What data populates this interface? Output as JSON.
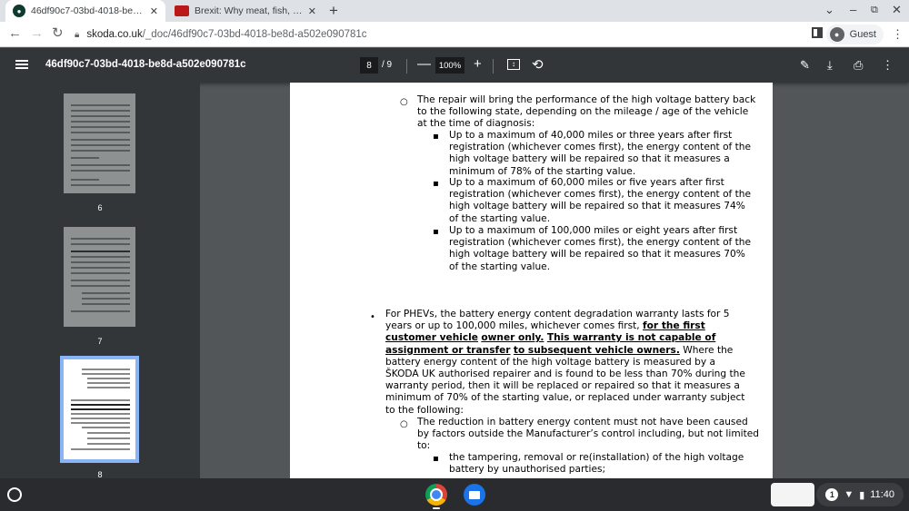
{
  "tabs": [
    {
      "title": "46df90c7-03bd-4018-be8d-a502e090781c",
      "favicon": "skoda-icon",
      "close": "✕"
    },
    {
      "title": "Brexit: Why meat, fish, cheese and...",
      "favicon": "news-icon",
      "close": "✕"
    }
  ],
  "newtab": "+",
  "address": {
    "host": "skoda.co.uk",
    "path": "/_doc/46df90c7-03bd-4018-be8d-a502e090781c"
  },
  "profile": {
    "label": "Guest"
  },
  "pdf": {
    "title": "46df90c7-03bd-4018-be8d-a502e090781c",
    "page_current": "8",
    "page_total": "/ 9",
    "zoom": "100%",
    "zoom_out": "—",
    "zoom_in": "+"
  },
  "thumbs": [
    {
      "num": "6"
    },
    {
      "num": "7"
    },
    {
      "num": "8"
    }
  ],
  "doc": {
    "repair_intro": [
      "The repair will bring the performance of the high voltage battery back",
      "to the following state, depending on the mileage / age of the vehicle",
      "at the time of diagnosis:"
    ],
    "b1": [
      "Up to a maximum of 40,000 miles or three years after first",
      "registration (whichever comes first), the energy content of the",
      "high voltage battery will be repaired so that it measures a",
      "minimum of 78% of the starting value."
    ],
    "b2": [
      "Up to a maximum of 60,000 miles or five years after first",
      "registration (whichever comes first), the energy content of the",
      "high voltage battery will be repaired so that it measures 74%",
      "of the starting value."
    ],
    "b3": [
      "Up to a maximum of 100,000 miles or eight years after first",
      "registration (whichever comes first), the energy content of the",
      "high voltage battery will be repaired so that it measures 70%",
      "of the starting value."
    ],
    "phev_l1": "For PHEVs, the battery energy content degradation warranty lasts for 5",
    "phev_l2a": "years or up to 100,000 miles, whichever comes first, ",
    "phev_l2b": "for the first",
    "phev_l3a": "customer vehicle",
    "phev_l3b": "owner only.",
    "phev_l3c": "This warranty is not capable of",
    "phev_l4a": "assignment or transfer",
    "phev_l4b": "to subsequent vehicle owners.",
    "phev_l4c": " Where the",
    "phev_rest": [
      "battery energy content of the high voltage battery is measured by a",
      "ŠKODA UK authorised repairer and is found to be less than 70% during the",
      "warranty period, then it will be replaced or repaired so that it measures a",
      "minimum of 70% of the starting value, or replaced under warranty subject",
      "to the following:"
    ],
    "reduction": [
      "The reduction in battery energy content must not have been caused",
      "by factors outside the Manufacturer’s control including, but not limited",
      "to:"
    ],
    "tamper": [
      "the tampering, removal or re(installation) of the high voltage",
      "battery by unauthorised parties;"
    ]
  },
  "status": {
    "notifications": "1",
    "time": "11:40"
  }
}
